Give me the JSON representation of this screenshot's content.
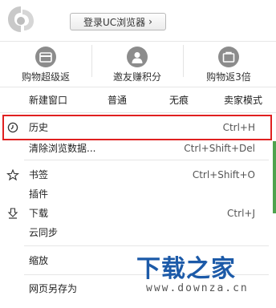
{
  "header": {
    "logo_icon": "uc-browser-logo-icon",
    "login_label": "登录UC浏览器",
    "login_chevron": "›"
  },
  "shortcuts": [
    {
      "label": "购物超级返",
      "icon": "wallet-icon"
    },
    {
      "label": "邀友赚积分",
      "icon": "user-icon"
    },
    {
      "label": "购物返3倍",
      "icon": "bag-icon"
    }
  ],
  "window_modes": {
    "new_window": "新建窗口",
    "normal": "普通",
    "incognito": "无痕",
    "seller": "卖家模式"
  },
  "items": {
    "history": {
      "label": "历史",
      "shortcut": "Ctrl+H",
      "icon": "clock-icon"
    },
    "clear_data": {
      "label": "清除浏览数据...",
      "shortcut": "Ctrl+Shift+Del"
    },
    "bookmarks": {
      "label": "书签",
      "shortcut": "Ctrl+Shift+O",
      "icon": "star-icon"
    },
    "plugins": {
      "label": "插件"
    },
    "downloads": {
      "label": "下载",
      "shortcut": "Ctrl+J",
      "icon": "download-icon"
    },
    "cloud_sync": {
      "label": "云同步"
    },
    "zoom": {
      "label": "缩放"
    },
    "save_as": {
      "label": "网页另存为"
    }
  },
  "colors": {
    "highlight_border": "#e02020",
    "watermark_blue": "#1c5aa8",
    "icon_gray": "#8c8c8c"
  }
}
